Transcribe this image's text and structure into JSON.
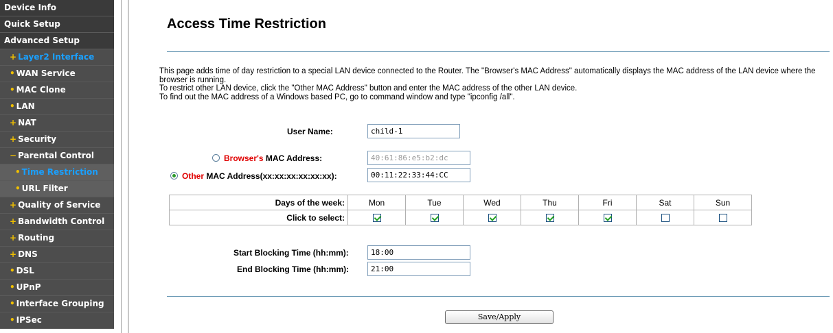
{
  "sidebar": {
    "items": [
      {
        "marker": "",
        "label": "Device Info",
        "level": "top",
        "active": false
      },
      {
        "marker": "",
        "label": "Quick Setup",
        "level": "top",
        "active": false
      },
      {
        "marker": "",
        "label": "Advanced Setup",
        "level": "top",
        "active": false
      },
      {
        "marker": "+",
        "label": "Layer2 Interface",
        "level": "sub",
        "active": true
      },
      {
        "marker": "•",
        "label": "WAN Service",
        "level": "sub",
        "active": false
      },
      {
        "marker": "•",
        "label": "MAC Clone",
        "level": "sub",
        "active": false
      },
      {
        "marker": "•",
        "label": "LAN",
        "level": "sub",
        "active": false
      },
      {
        "marker": "+",
        "label": "NAT",
        "level": "sub",
        "active": false
      },
      {
        "marker": "+",
        "label": "Security",
        "level": "sub",
        "active": false
      },
      {
        "marker": "−",
        "label": "Parental Control",
        "level": "sub",
        "active": false
      },
      {
        "marker": "•",
        "label": "Time Restriction",
        "level": "subsub",
        "active": true
      },
      {
        "marker": "•",
        "label": "URL Filter",
        "level": "subsub",
        "active": false
      },
      {
        "marker": "+",
        "label": "Quality of Service",
        "level": "sub",
        "active": false
      },
      {
        "marker": "+",
        "label": "Bandwidth Control",
        "level": "sub",
        "active": false
      },
      {
        "marker": "+",
        "label": "Routing",
        "level": "sub",
        "active": false
      },
      {
        "marker": "+",
        "label": "DNS",
        "level": "sub",
        "active": false
      },
      {
        "marker": "•",
        "label": "DSL",
        "level": "sub",
        "active": false
      },
      {
        "marker": "•",
        "label": "UPnP",
        "level": "sub",
        "active": false
      },
      {
        "marker": "•",
        "label": "Interface Grouping",
        "level": "sub",
        "active": false
      },
      {
        "marker": "•",
        "label": "IPSec",
        "level": "sub",
        "active": false
      }
    ],
    "colors": {
      "item_bg": "#3f3f3f",
      "active_text": "#1aa0ff",
      "marker": "#f0c000"
    }
  },
  "main": {
    "title": "Access Time Restriction",
    "description": [
      "This page adds time of day restriction to a special LAN device connected to the Router. The \"Browser's MAC Address\" automatically displays the MAC address of the LAN device where the browser is running.",
      "To restrict other LAN device, click the \"Other MAC Address\" button and enter the MAC address of the other LAN device.",
      "To find out the MAC address of a Windows based PC, go to command window and type \"ipconfig /all\"."
    ],
    "user_name": {
      "label": "User Name:",
      "value": "child-1"
    },
    "browser_mac": {
      "label_red": "Browser's",
      "label_rest": " MAC Address:",
      "value": "40:61:86:e5:b2:dc",
      "selected": false
    },
    "other_mac": {
      "label_red": "Other",
      "label_rest": " MAC Address(xx:xx:xx:xx:xx:xx):",
      "value": "00:11:22:33:44:CC",
      "selected": true
    },
    "days": {
      "header_label": "Days of the week:",
      "select_label": "Click to select:",
      "names": [
        "Mon",
        "Tue",
        "Wed",
        "Thu",
        "Fri",
        "Sat",
        "Sun"
      ],
      "checked": [
        true,
        true,
        true,
        true,
        true,
        false,
        false
      ]
    },
    "start_time": {
      "label": "Start Blocking Time (hh:mm):",
      "value": "18:00"
    },
    "end_time": {
      "label": "End Blocking Time (hh:mm):",
      "value": "21:00"
    },
    "save_label": "Save/Apply",
    "colors": {
      "accent_red": "#e00000",
      "divider": "#5b8fae",
      "check": "#21a121"
    }
  }
}
